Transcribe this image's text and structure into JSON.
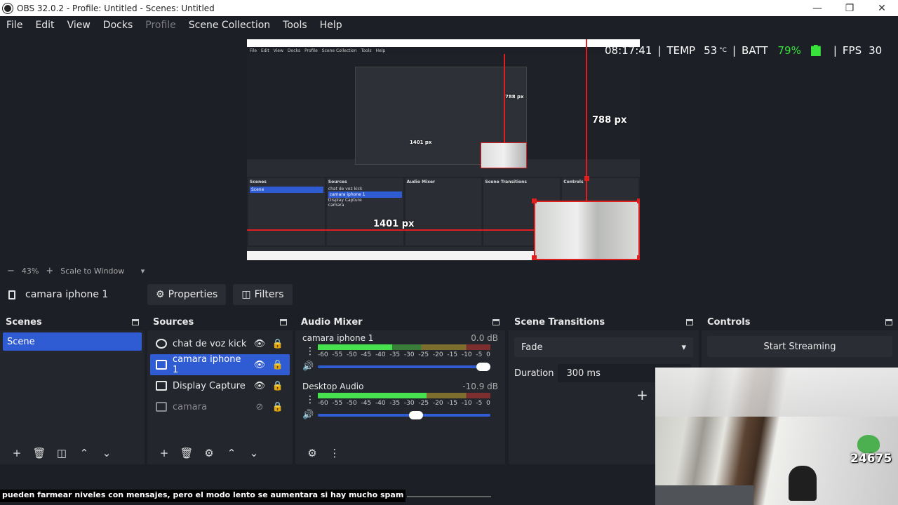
{
  "window": {
    "title": "OBS 32.0.2 - Profile: Untitled - Scenes: Untitled"
  },
  "menu": [
    "File",
    "Edit",
    "View",
    "Docks",
    "Profile",
    "Scene Collection",
    "Tools",
    "Help"
  ],
  "preview": {
    "measure_vertical": "788 px",
    "measure_horizontal": "1401 px",
    "nested_vertical": "788 px",
    "nested_horizontal": "1401 px"
  },
  "overlay": {
    "time": "08:17:41",
    "temp_label": "TEMP",
    "temp_value": "53",
    "temp_unit": "°C",
    "batt_label": "BATT",
    "batt_value": "79%",
    "fps_label": "FPS",
    "fps_value": "30"
  },
  "zoom": {
    "minus": "−",
    "value": "43%",
    "plus": "+",
    "scale_mode": "Scale to Window"
  },
  "source_toolbar": {
    "selected_source": "camara iphone 1",
    "properties": "Properties",
    "filters": "Filters"
  },
  "scenes": {
    "title": "Scenes",
    "items": [
      "Scene"
    ]
  },
  "sources": {
    "title": "Sources",
    "items": [
      {
        "name": "chat de voz kick"
      },
      {
        "name": "camara iphone 1"
      },
      {
        "name": "Display Capture"
      },
      {
        "name": "camara"
      }
    ]
  },
  "mixer": {
    "title": "Audio Mixer",
    "scale": [
      "-60",
      "-55",
      "-50",
      "-45",
      "-40",
      "-35",
      "-30",
      "-25",
      "-20",
      "-15",
      "-10",
      "-5",
      "0"
    ],
    "channels": [
      {
        "name": "camara iphone 1",
        "db": "0.0 dB",
        "level": 0.43,
        "volume": 1.0
      },
      {
        "name": "Desktop Audio",
        "db": "-10.9 dB",
        "level": 0.63,
        "volume": 0.61
      }
    ]
  },
  "transitions": {
    "title": "Scene Transitions",
    "selected": "Fade",
    "duration_label": "Duration",
    "duration_value": "300 ms"
  },
  "controls": {
    "title": "Controls",
    "start_streaming": "Start Streaming"
  },
  "stream": {
    "viewer_count": "24675",
    "subtitle": "pueden farmear niveles con mensajes, pero el modo lento se aumentara si hay mucho spam"
  }
}
